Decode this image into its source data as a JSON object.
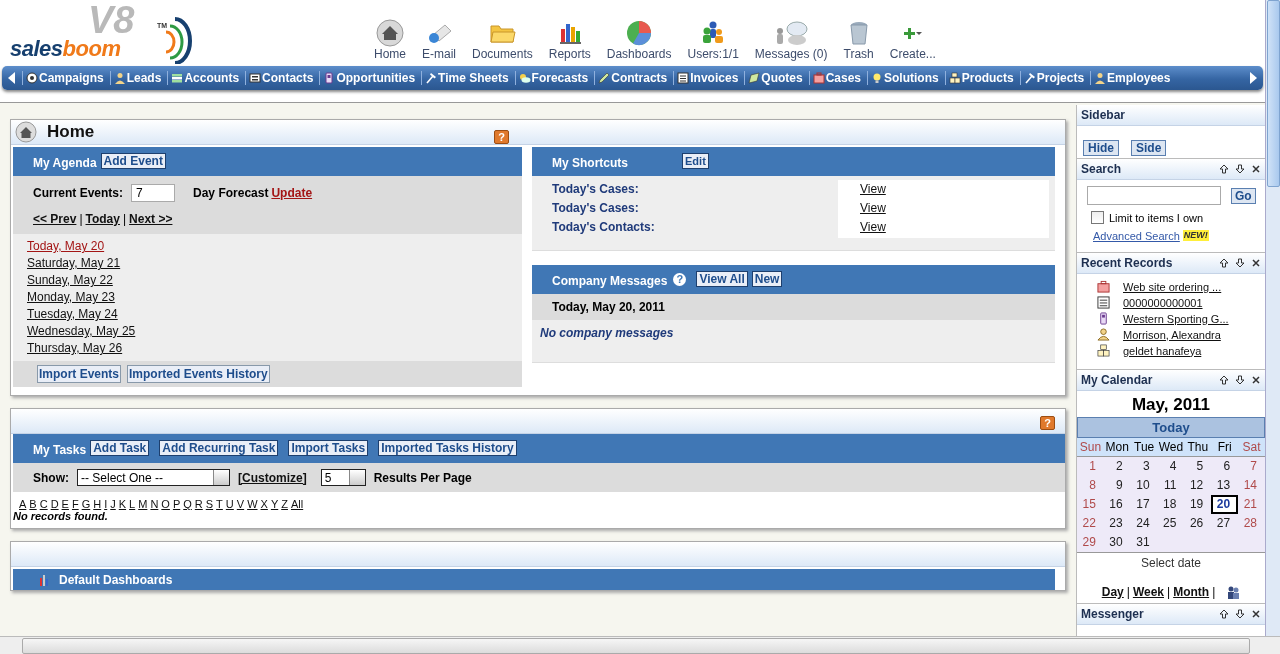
{
  "logo": {
    "name_left": "sales",
    "name_right": "boom",
    "version": "V8",
    "trademark": "TM"
  },
  "toolbar": [
    {
      "kind": "home",
      "label": "Home"
    },
    {
      "kind": "email",
      "label": "E-mail"
    },
    {
      "kind": "documents",
      "label": "Documents"
    },
    {
      "kind": "reports",
      "label": "Reports"
    },
    {
      "kind": "dashboards",
      "label": "Dashboards"
    },
    {
      "kind": "users",
      "label": "Users:1/1"
    },
    {
      "kind": "messages",
      "label": "Messages (0)"
    },
    {
      "kind": "trash",
      "label": "Trash"
    },
    {
      "kind": "create",
      "label": "Create..."
    }
  ],
  "nav": [
    {
      "kind": "target",
      "label": "Campaigns"
    },
    {
      "kind": "person",
      "label": "Leads"
    },
    {
      "kind": "stack",
      "label": "Accounts"
    },
    {
      "kind": "card",
      "label": "Contacts"
    },
    {
      "kind": "phone",
      "label": "Opportunities"
    },
    {
      "kind": "hammer",
      "label": "Time Sheets"
    },
    {
      "kind": "forecast",
      "label": "Forecasts"
    },
    {
      "kind": "pencil",
      "label": "Contracts"
    },
    {
      "kind": "calculator",
      "label": "Invoices"
    },
    {
      "kind": "quote",
      "label": "Quotes"
    },
    {
      "kind": "case",
      "label": "Cases"
    },
    {
      "kind": "bulb",
      "label": "Solutions"
    },
    {
      "kind": "boxes",
      "label": "Products"
    },
    {
      "kind": "hammer",
      "label": "Projects"
    },
    {
      "kind": "person",
      "label": "Employees"
    }
  ],
  "home_panel": {
    "title": "Home",
    "help": "?"
  },
  "agenda": {
    "title": "My Agenda",
    "add_button": "Add Event",
    "current_events_label": "Current Events:",
    "current_events_value": "7",
    "forecast_label": "Day Forecast",
    "update_link": "Update",
    "pager": [
      {
        "kind": "link",
        "text": "<< Prev"
      },
      {
        "kind": "separator",
        "text": "|"
      },
      {
        "kind": "link",
        "text": "Today"
      },
      {
        "kind": "separator",
        "text": "|"
      },
      {
        "kind": "link",
        "text": "Next >>"
      }
    ],
    "days": [
      {
        "label": "Today, May 20",
        "today": true
      },
      {
        "label": "Saturday, May 21",
        "today": false
      },
      {
        "label": "Sunday, May 22",
        "today": false
      },
      {
        "label": "Monday, May 23",
        "today": false
      },
      {
        "label": "Tuesday, May 24",
        "today": false
      },
      {
        "label": "Wednesday, May 25",
        "today": false
      },
      {
        "label": "Thursday, May 26",
        "today": false
      }
    ],
    "footer_buttons": [
      "Import Events",
      "Imported Events History"
    ]
  },
  "shortcuts": {
    "title": "My Shortcuts",
    "edit_button": "Edit",
    "rows": [
      {
        "label": "Today's Cases:",
        "link": "View"
      },
      {
        "label": "Today's Cases:",
        "link": "View"
      },
      {
        "label": "Today's Contacts:",
        "link": "View"
      }
    ]
  },
  "company_messages": {
    "title": "Company Messages",
    "help": "?",
    "buttons": [
      "View All",
      "New"
    ],
    "date": "Today, May 20, 2011",
    "empty": "No company messages"
  },
  "tasks": {
    "help": "?",
    "title": "My Tasks",
    "buttons": [
      "Add Task",
      "Add Recurring Task",
      "Import Tasks",
      "Imported Tasks History"
    ],
    "show_label": "Show:",
    "show_value": "-- Select One --",
    "customize_link": "[Customize]",
    "per_page_value": "5",
    "per_page_label": "Results Per Page",
    "letters": [
      "A",
      "B",
      "C",
      "D",
      "E",
      "F",
      "G",
      "H",
      "I",
      "J",
      "K",
      "L",
      "M",
      "N",
      "O",
      "P",
      "Q",
      "R",
      "S",
      "T",
      "U",
      "V",
      "W",
      "X",
      "Y",
      "Z",
      "All"
    ],
    "empty": "No records found."
  },
  "dashboards": {
    "title": "Default Dashboards"
  },
  "sidebar": {
    "title": "Sidebar",
    "buttons": [
      "Hide",
      "Side"
    ]
  },
  "search": {
    "title": "Search",
    "go_button": "Go",
    "limit_label": "Limit to items I own",
    "limit_checked": false,
    "advanced_link": "Advanced Search",
    "new_badge": "NEW!"
  },
  "recent": {
    "title": "Recent Records",
    "items": [
      {
        "kind": "case",
        "label": "Web site ordering ..."
      },
      {
        "kind": "invoice",
        "label": "0000000000001"
      },
      {
        "kind": "opportunity",
        "label": "Western Sporting G..."
      },
      {
        "kind": "contact",
        "label": "Morrison, Alexandra"
      },
      {
        "kind": "product",
        "label": "geldet hanafeya"
      }
    ]
  },
  "calendar": {
    "title": "My Calendar",
    "month": "May, 2011",
    "today_button": "Today",
    "weekdays": [
      {
        "label": "Sun",
        "weekend": true
      },
      {
        "label": "Mon",
        "weekend": false
      },
      {
        "label": "Tue",
        "weekend": false
      },
      {
        "label": "Wed",
        "weekend": false
      },
      {
        "label": "Thu",
        "weekend": false
      },
      {
        "label": "Fri",
        "weekend": false
      },
      {
        "label": "Sat",
        "weekend": true
      }
    ],
    "weeks": [
      [
        {
          "day": "1",
          "selected": false
        },
        {
          "day": "2",
          "selected": false
        },
        {
          "day": "3",
          "selected": false
        },
        {
          "day": "4",
          "selected": false
        },
        {
          "day": "5",
          "selected": false
        },
        {
          "day": "6",
          "selected": false
        },
        {
          "day": "7",
          "selected": false
        }
      ],
      [
        {
          "day": "8",
          "selected": false
        },
        {
          "day": "9",
          "selected": false
        },
        {
          "day": "10",
          "selected": false
        },
        {
          "day": "11",
          "selected": false
        },
        {
          "day": "12",
          "selected": false
        },
        {
          "day": "13",
          "selected": false
        },
        {
          "day": "14",
          "selected": false
        }
      ],
      [
        {
          "day": "15",
          "selected": false
        },
        {
          "day": "16",
          "selected": false
        },
        {
          "day": "17",
          "selected": false
        },
        {
          "day": "18",
          "selected": false
        },
        {
          "day": "19",
          "selected": false
        },
        {
          "day": "20",
          "selected": true
        },
        {
          "day": "21",
          "selected": false
        }
      ],
      [
        {
          "day": "22",
          "selected": false
        },
        {
          "day": "23",
          "selected": false
        },
        {
          "day": "24",
          "selected": false
        },
        {
          "day": "25",
          "selected": false
        },
        {
          "day": "26",
          "selected": false
        },
        {
          "day": "27",
          "selected": false
        },
        {
          "day": "28",
          "selected": false
        }
      ],
      [
        {
          "day": "29",
          "selected": false
        },
        {
          "day": "30",
          "selected": false
        },
        {
          "day": "31",
          "selected": false
        }
      ]
    ],
    "select_hint": "Select date",
    "views": [
      {
        "kind": "link",
        "text": "Day"
      },
      {
        "kind": "separator",
        "text": "|"
      },
      {
        "kind": "link",
        "text": "Week"
      },
      {
        "kind": "separator",
        "text": "|"
      },
      {
        "kind": "link",
        "text": "Month"
      },
      {
        "kind": "separator",
        "text": "|"
      }
    ]
  },
  "messenger": {
    "title": "Messenger"
  }
}
